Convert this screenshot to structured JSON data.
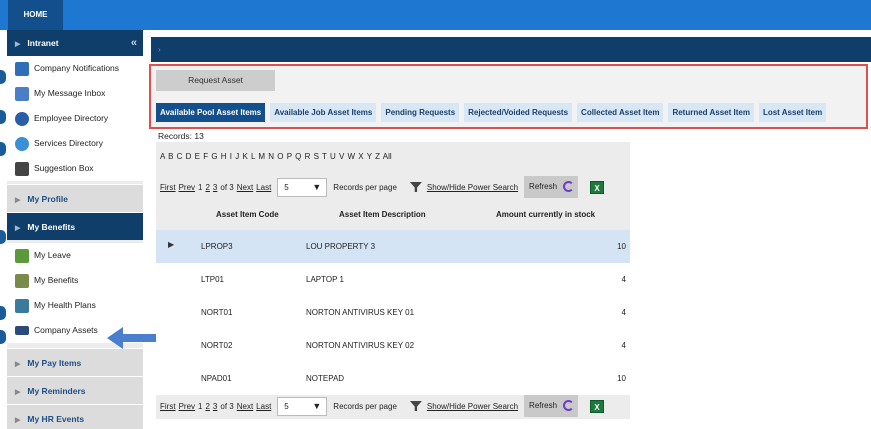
{
  "top_nav": {
    "home_tab": "HOME"
  },
  "sidebar": {
    "header": "Intranet",
    "intranet_items": [
      {
        "label": "Company Notifications",
        "icon": "notifications-icon",
        "color": "#2f6fb8"
      },
      {
        "label": "My Message Inbox",
        "icon": "inbox-icon",
        "color": "#4a7fc8"
      },
      {
        "label": "Employee Directory",
        "icon": "directory-icon",
        "color": "#2b5ea8"
      },
      {
        "label": "Services Directory",
        "icon": "services-icon",
        "color": "#3a90d4"
      },
      {
        "label": "Suggestion Box",
        "icon": "suggestion-box-icon",
        "color": "#444444"
      }
    ],
    "sections": {
      "my_profile": "My Profile",
      "my_benefits": "My Benefits",
      "my_pay_items": "My Pay Items",
      "my_reminders": "My Reminders",
      "my_hr_events": "My HR Events"
    },
    "benefit_items": [
      {
        "label": "My Leave",
        "icon": "palm-tree-icon",
        "color": "#5a9a3a"
      },
      {
        "label": "My Benefits",
        "icon": "money-stack-icon",
        "color": "#7a8a4a"
      },
      {
        "label": "My Health Plans",
        "icon": "health-shield-icon",
        "color": "#3a7a9a"
      },
      {
        "label": "Company Assets",
        "icon": "car-icon",
        "color": "#2a4a7a"
      }
    ]
  },
  "content": {
    "header_arrow": "›",
    "request_button": "Request Asset",
    "tabs": [
      "Available Pool Asset Items",
      "Available Job Asset Items",
      "Pending Requests",
      "Rejected/Voided Requests",
      "Collected Asset Item",
      "Returned Asset Item",
      "Lost Asset Item"
    ],
    "records_label": "Records:",
    "records_count": "13",
    "alphabet": "A B C D E F G H I J K L M N O P Q R S T U V W X Y Z All",
    "pager": {
      "first": "First",
      "prev": "Prev",
      "page1": "1",
      "page2": "2",
      "page3": "3",
      "of": "of 3",
      "next": "Next",
      "last": "Last",
      "page_size": "5",
      "records_per_page": "Records per page",
      "power_search": "Show/Hide Power Search",
      "refresh": "Refresh"
    },
    "columns": {
      "code": "Asset Item Code",
      "description": "Asset Item Description",
      "amount": "Amount currently in stock"
    },
    "rows": [
      {
        "code": "LPROP3",
        "description": "LOU PROPERTY 3",
        "amount": "10"
      },
      {
        "code": "LTP01",
        "description": "LAPTOP 1",
        "amount": "4"
      },
      {
        "code": "NORT01",
        "description": "NORTON ANTIVIRUS KEY 01",
        "amount": "4"
      },
      {
        "code": "NORT02",
        "description": "NORTON ANTIVIRUS KEY 02",
        "amount": "4"
      },
      {
        "code": "NPAD01",
        "description": "NOTEPAD",
        "amount": "10"
      }
    ]
  },
  "colors": {
    "top_bar": "#1e78d2",
    "nav_dark": "#0f3e6b",
    "highlight_box": "#de5050",
    "selected_row": "#d5e4f5",
    "callout_arrow": "#4a7fd0"
  }
}
